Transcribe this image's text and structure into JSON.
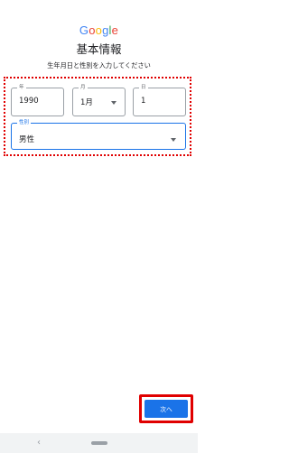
{
  "header": {
    "logo_letters": [
      {
        "char": "G",
        "color": "#4285F4"
      },
      {
        "char": "o",
        "color": "#EA4335"
      },
      {
        "char": "o",
        "color": "#FBBC05"
      },
      {
        "char": "g",
        "color": "#4285F4"
      },
      {
        "char": "l",
        "color": "#34A853"
      },
      {
        "char": "e",
        "color": "#EA4335"
      }
    ],
    "title": "基本情報",
    "subtitle": "生年月日と性別を入力してください"
  },
  "form": {
    "year": {
      "label": "年",
      "value": "1990"
    },
    "month": {
      "label": "月",
      "value": "1月"
    },
    "day": {
      "label": "日",
      "value": "1"
    },
    "gender": {
      "label": "性別",
      "value": "男性"
    }
  },
  "actions": {
    "next_label": "次へ"
  },
  "navbar": {
    "back_glyph": "‹"
  },
  "colors": {
    "accent": "#1a73e8",
    "highlight": "#e00000"
  }
}
